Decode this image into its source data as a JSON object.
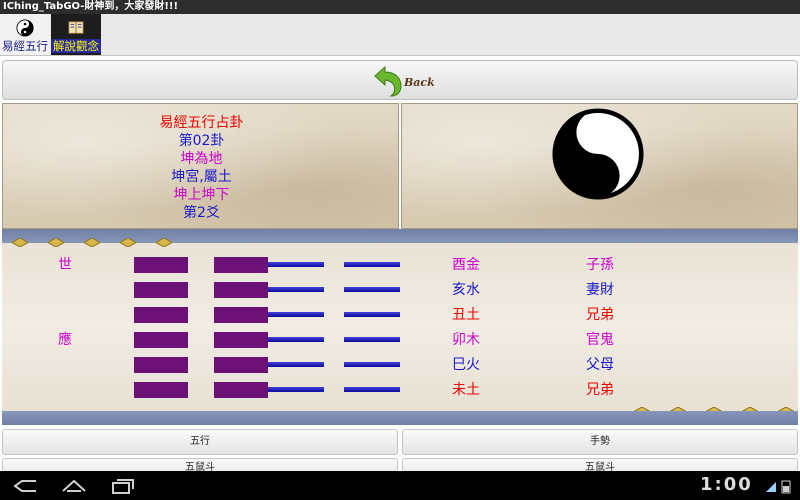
{
  "window": {
    "title": "IChing_TabGO-財神到，大家發財!!!"
  },
  "tabs": [
    {
      "label": "易經五行",
      "icon": "yin-yang-icon",
      "active": true
    },
    {
      "label": "解說觀念",
      "icon": "book-icon",
      "active": false
    }
  ],
  "toolbar": {
    "back_label": "Back",
    "back_icon": "back-arrow-icon"
  },
  "info": {
    "title": "易經五行占卦",
    "number": "第02卦",
    "name": "坤為地",
    "palace": "坤宮,屬土",
    "structure": "坤上坤下",
    "line": "第2爻"
  },
  "hexagram": {
    "rows": [
      {
        "mark": "世",
        "branch": "酉金",
        "relation": "子孫"
      },
      {
        "mark": "",
        "branch": "亥水",
        "relation": "妻財"
      },
      {
        "mark": "",
        "branch": "丑土",
        "relation": "兄弟"
      },
      {
        "mark": "應",
        "branch": "卯木",
        "relation": "官鬼"
      },
      {
        "mark": "",
        "branch": "巳火",
        "relation": "父母"
      },
      {
        "mark": "",
        "branch": "未土",
        "relation": "兄弟"
      }
    ]
  },
  "buttons": {
    "wuxing": "五行",
    "gesture": "手勢",
    "row2_left": "五鼠斗",
    "row2_right": "五鼠斗"
  },
  "status": {
    "time": "1:00"
  },
  "colors": {
    "title_red": "#ee0000",
    "text_blue": "#1a1acc",
    "text_magenta": "#cc00cc",
    "yin_bar": "#6b1177",
    "line_blue": "#0c0c9e",
    "fire_red": "#ee0000",
    "water_blue": "#1a1acc",
    "metal_magenta": "#cc00cc"
  }
}
